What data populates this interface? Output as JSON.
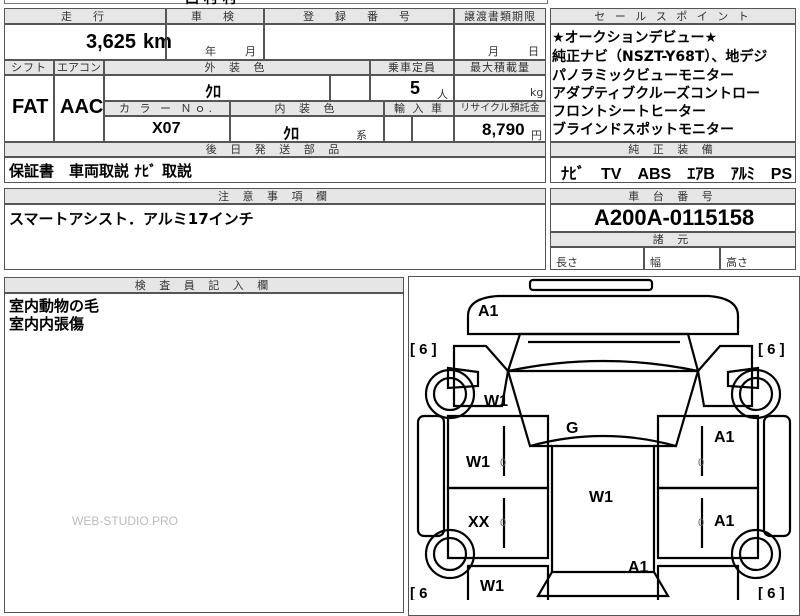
{
  "top_row": {
    "partial_text": "西 村 村"
  },
  "mileage": {
    "header": "走　行",
    "value": "3,625",
    "unit": "km"
  },
  "inspection": {
    "header": "車　検",
    "year_label": "年",
    "month_label": "月"
  },
  "registration": {
    "header": "登　録　番　号"
  },
  "transfer_deadline": {
    "header": "譲渡書類期限",
    "month_label": "月",
    "day_label": "日"
  },
  "shift": {
    "header": "シフト",
    "value": "FAT"
  },
  "aircon": {
    "header": "エアコン",
    "value": "AAC"
  },
  "exterior_color": {
    "header": "外 装 色",
    "value": "ｸﾛ"
  },
  "capacity": {
    "header": "乗車定員",
    "value": "5",
    "unit": "人"
  },
  "max_load": {
    "header": "最大積載量",
    "unit": "kg"
  },
  "color_no": {
    "header": "カ ラ ー Ｎｏ.",
    "value": "X07"
  },
  "interior_color": {
    "header": "内 装 色",
    "value": "ｸﾛ",
    "suffix": "系"
  },
  "import_car": {
    "header": "輸 入 車"
  },
  "recycle": {
    "header": "リサイクル預託金",
    "value": "8,790",
    "unit": "円"
  },
  "later_parts": {
    "header": "後 日 発 送 部 品",
    "value": "保証書　車両取説 ﾅﾋﾞ 取説"
  },
  "notes": {
    "header": "注 意 事 項 欄",
    "value": "スマートアシスト．アルミ17インチ"
  },
  "inspector": {
    "header": "検 査 員 記 入 欄",
    "lines": [
      "室内動物の毛",
      "室内内張傷"
    ]
  },
  "watermark": "WEB-STUDIO.PRO",
  "sales_points": {
    "header": "セ ー ル ス ポ イ ン ト",
    "lines": [
      "★オークションデビュー★",
      "純正ナビ（NSZT-Y68T）、地デジ",
      "パノラミックビューモニター",
      "アダプティブクルーズコントロー",
      "フロントシートヒーター",
      "ブラインドスポットモニター"
    ]
  },
  "equipment": {
    "header": "純 正 装 備",
    "value": "ﾅﾋﾞ　TV　ABS　ｴｱB　ｱﾙﾐ　PS　PW"
  },
  "chassis": {
    "header": "車 台 番 号",
    "value": "A200A-0115158"
  },
  "dimensions": {
    "header": "諸 元",
    "length": "長さ",
    "width": "幅",
    "height": "高さ"
  },
  "diagram_marks": {
    "a1_top": "A1",
    "w1_front_left": "W1",
    "g_windshield": "G",
    "a1_front_right": "A1",
    "w1_front_door_left": "W1",
    "w1_roof": "W1",
    "xx_rear_door_left": "XX",
    "a1_rear_door_right": "A1",
    "a1_rear": "A1",
    "w1_rear_left": "W1",
    "tire_fl": "[ 6 ]",
    "tire_fr": "[ 6 ]",
    "tire_rl": "[ 6",
    "tire_rr": "[ 6 ]",
    "small_0_a": "0",
    "small_0_b": "0",
    "small_0_c": "0",
    "small_0_d": "0"
  }
}
